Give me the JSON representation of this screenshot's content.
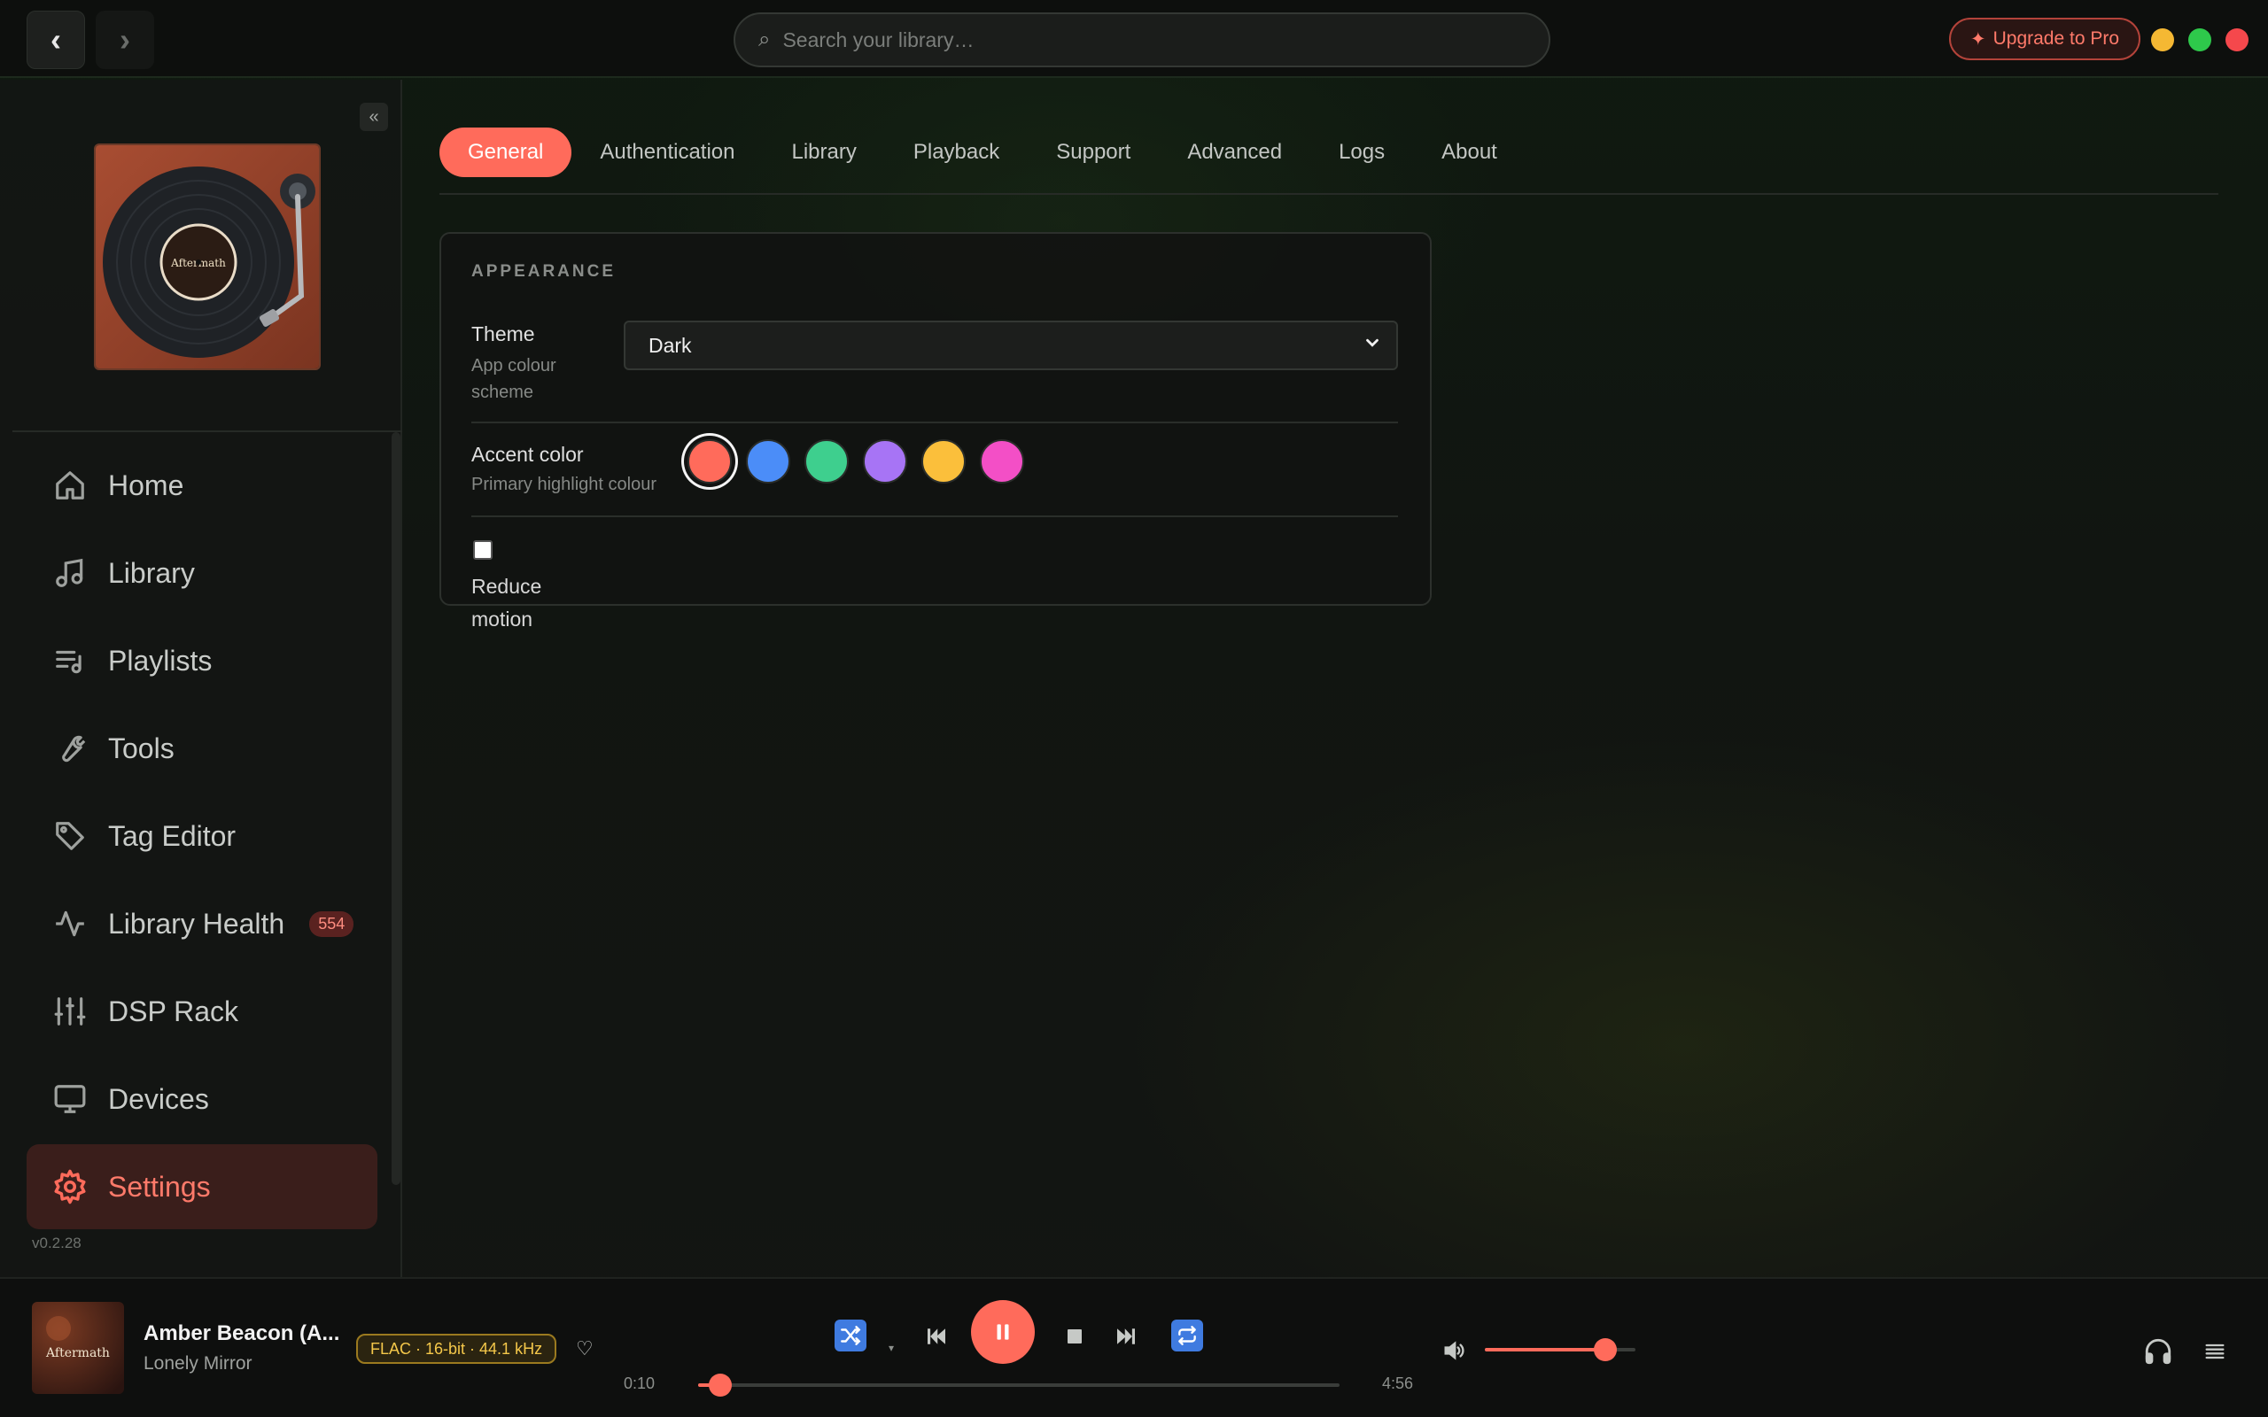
{
  "colors": {
    "accent": "#ff6b5b",
    "background": "#121412",
    "badge_text": "#ff8d80",
    "quality": "#f5c84a"
  },
  "topbar": {
    "back_icon": "chevron-left-icon",
    "forward_icon": "chevron-right-icon",
    "search_placeholder": "Search your library…",
    "upgrade_label": "Upgrade to Pro",
    "window_controls": [
      "minimize",
      "maximize",
      "close"
    ]
  },
  "sidebar": {
    "album_cover_text": "Aftermath",
    "items": [
      {
        "label": "Home",
        "icon": "home-icon"
      },
      {
        "label": "Library",
        "icon": "music-note-icon"
      },
      {
        "label": "Playlists",
        "icon": "playlist-icon"
      },
      {
        "label": "Tools",
        "icon": "wrench-icon"
      },
      {
        "label": "Tag Editor",
        "icon": "tag-icon"
      },
      {
        "label": "Library Health",
        "icon": "activity-icon",
        "badge": "554"
      },
      {
        "label": "DSP Rack",
        "icon": "sliders-icon"
      },
      {
        "label": "Devices",
        "icon": "monitor-icon"
      },
      {
        "label": "Settings",
        "icon": "gear-icon",
        "active": true
      }
    ],
    "version": "v0.2.28"
  },
  "tabs": [
    "General",
    "Authentication",
    "Library",
    "Playback",
    "Support",
    "Advanced",
    "Logs",
    "About"
  ],
  "active_tab": "General",
  "appearance": {
    "section_title": "APPEARANCE",
    "theme_label": "Theme",
    "theme_sub": "App colour scheme",
    "theme_value": "Dark",
    "accent_label": "Accent color",
    "accent_sub": "Primary highlight colour",
    "accent_swatches": [
      "#ff6b5b",
      "#4b8df8",
      "#3ecf8e",
      "#a774f5",
      "#fbbf3b",
      "#f34fc6"
    ],
    "accent_selected": "#ff6b5b",
    "reduce_motion_label": "Reduce motion",
    "reduce_motion_checked": false
  },
  "player": {
    "title": "Amber Beacon (A...",
    "artist": "Lonely Mirror",
    "quality": "FLAC · 16-bit · 44.1 kHz",
    "time_current": "0:10",
    "time_total": "4:56",
    "progress_fraction": 0.034,
    "volume_fraction": 0.8,
    "art_text": "Aftermath"
  }
}
